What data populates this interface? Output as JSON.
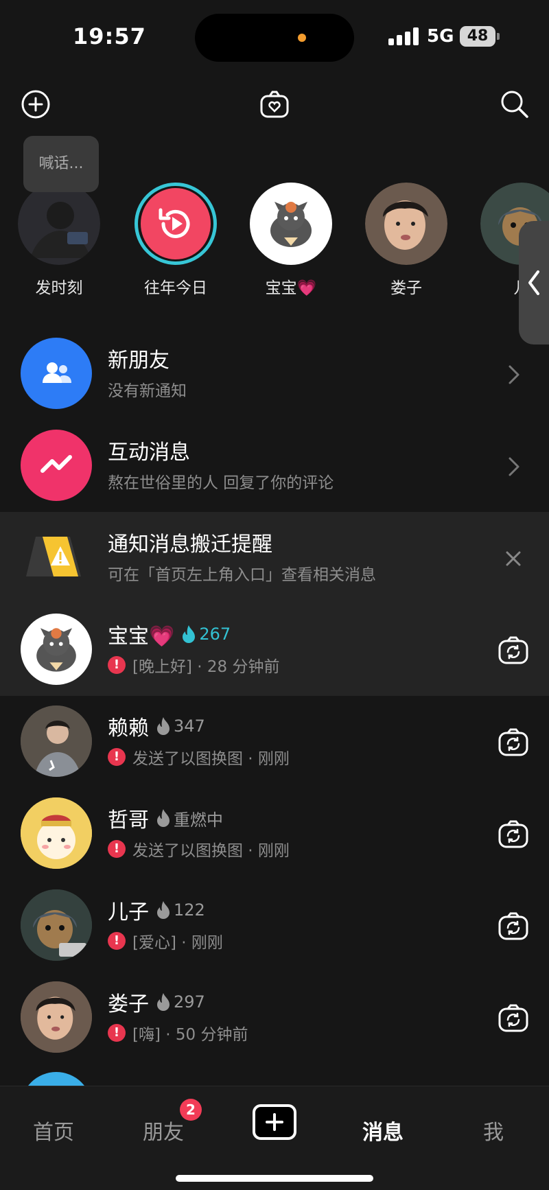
{
  "status": {
    "time": "19:57",
    "network": "5G",
    "battery": "48"
  },
  "bubble_text": "喊话...",
  "stories": [
    {
      "label": "发时刻"
    },
    {
      "label": "往年今日"
    },
    {
      "label": "宝宝💗"
    },
    {
      "label": "娄子"
    },
    {
      "label": "儿"
    }
  ],
  "rows": {
    "new_friends": {
      "title": "新朋友",
      "sub": "没有新通知"
    },
    "interactions": {
      "title": "互动消息",
      "sub": "熬在世俗里的人 回复了你的评论"
    },
    "notice": {
      "title": "通知消息搬迁提醒",
      "sub": "可在「首页左上角入口」查看相关消息"
    }
  },
  "chats": [
    {
      "name": "宝宝💗",
      "streak": "267",
      "message": "[晚上好] · 28 分钟前"
    },
    {
      "name": "赖赖",
      "streak": "347",
      "message": "发送了以图换图 · 刚刚"
    },
    {
      "name": "哲哥",
      "streak": "重燃中",
      "message": "发送了以图换图 · 刚刚"
    },
    {
      "name": "儿子",
      "streak": "122",
      "message": "[爱心] · 刚刚"
    },
    {
      "name": "娄子",
      "streak": "297",
      "message": "[嗨] · 50 分钟前"
    }
  ],
  "nav": {
    "home": "首页",
    "friends": "朋友",
    "friends_badge": "2",
    "messages": "消息",
    "me": "我"
  },
  "colors": {
    "accent_cyan": "#33c2d3",
    "alert_red": "#e8364f",
    "blue_icon": "#2d7cf6",
    "pink_icon": "#f0336a"
  }
}
